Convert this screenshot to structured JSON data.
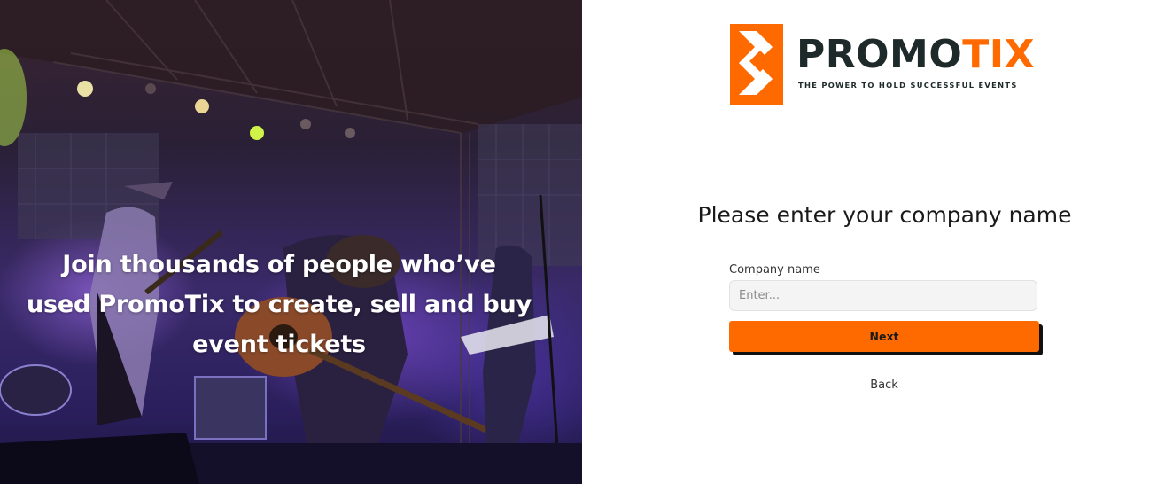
{
  "hero": {
    "tagline": "Join thousands of people who’ve used PromoTix to create, sell and buy event tickets"
  },
  "brand": {
    "name_primary": "PROMO",
    "name_accent": "TIX",
    "tagline": "THE POWER TO HOLD SUCCESSFUL EVENTS",
    "accent_color": "#ff6a00",
    "dark_color": "#1e2a2a"
  },
  "form": {
    "heading": "Please enter your company name",
    "company_label": "Company name",
    "company_placeholder": "Enter...",
    "company_value": "",
    "next_label": "Next",
    "back_label": "Back"
  }
}
